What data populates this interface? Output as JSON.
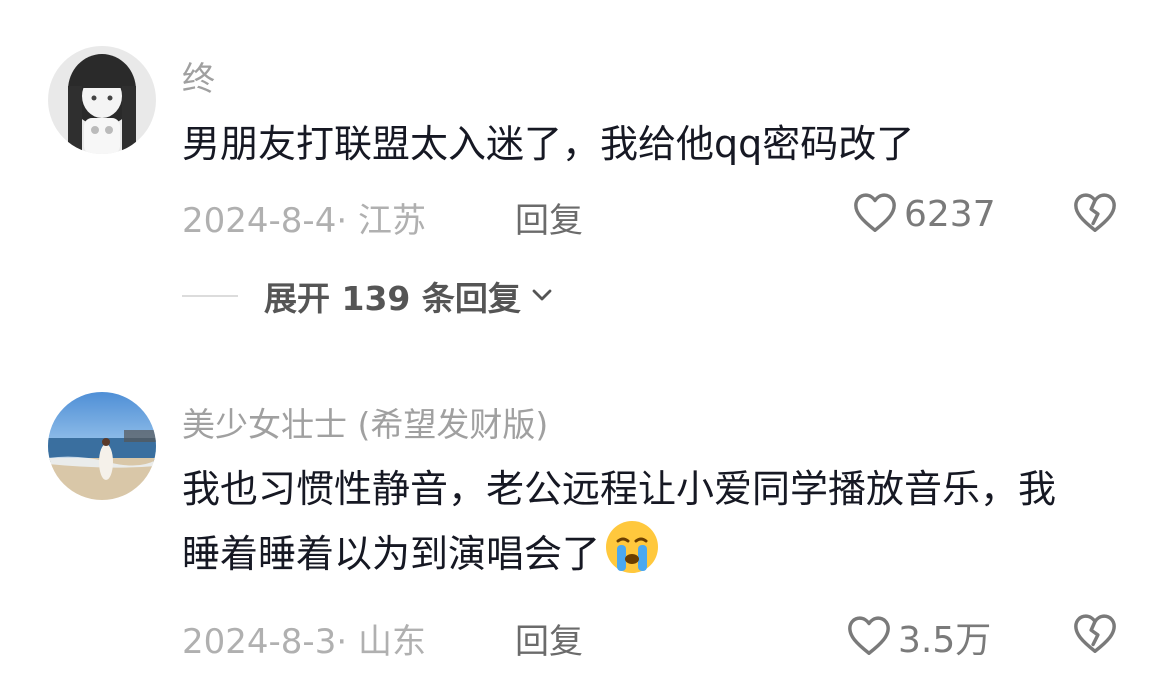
{
  "comments": [
    {
      "username": "终",
      "text": "男朋友打联盟太入迷了，我给他qq密码改了",
      "date_location": "2024-8-4· 江苏",
      "reply_label": "回复",
      "likes": "6237",
      "expand_label": "展开 139 条回复"
    },
    {
      "username": "美少女壮士 (希望发财版)",
      "text": "我也习惯性静音，老公远程让小爱同学播放音乐，我睡着睡着以为到演唱会了",
      "emoji": "loudly-crying-face",
      "date_location": "2024-8-3· 山东",
      "reply_label": "回复",
      "likes": "3.5万"
    }
  ],
  "colors": {
    "text": "#161823",
    "secondary": "#a0a0a0",
    "icon": "#7a7a7a"
  }
}
